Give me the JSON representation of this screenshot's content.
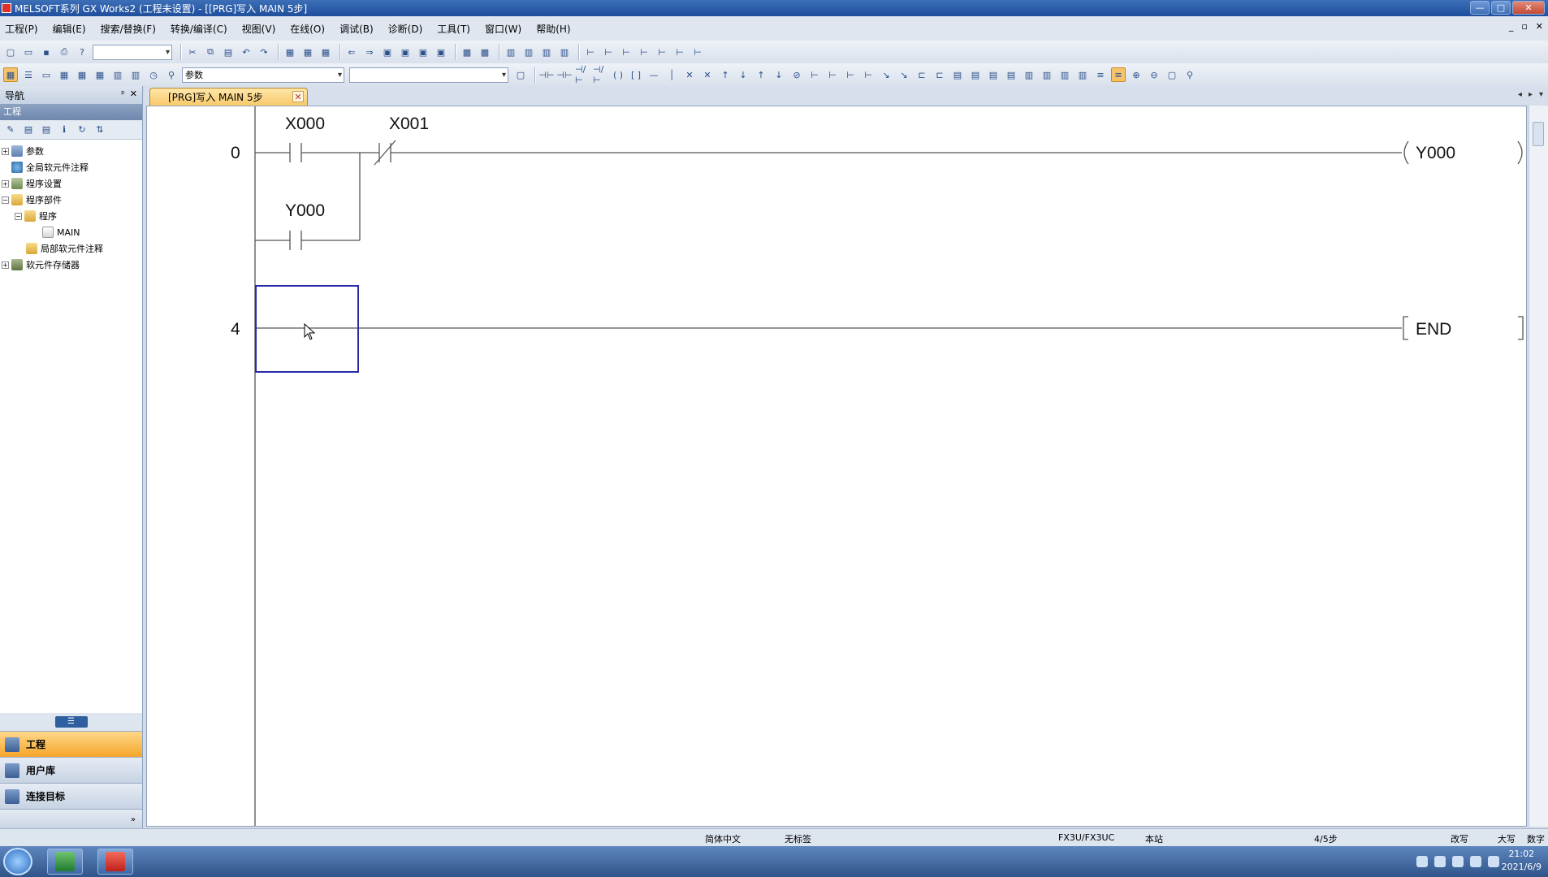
{
  "window": {
    "title": "MELSOFT系列 GX Works2 (工程未设置) - [[PRG]写入 MAIN 5步]",
    "min": "—",
    "max": "□",
    "close": "✕"
  },
  "menu": [
    "工程(P)",
    "编辑(E)",
    "搜索/替换(F)",
    "转换/编译(C)",
    "视图(V)",
    "在线(O)",
    "调试(B)",
    "诊断(D)",
    "工具(T)",
    "窗口(W)",
    "帮助(H)"
  ],
  "toolbar2": {
    "device_combo_value": "参数"
  },
  "nav": {
    "title": "导航",
    "pin": "ᵖ",
    "close": "✕",
    "section": "工程",
    "tree": [
      {
        "label": "参数",
        "level": 0,
        "exp": "+",
        "icon": "param-icon"
      },
      {
        "label": "全局软元件注释",
        "level": 0,
        "exp": "",
        "icon": "globe-icon"
      },
      {
        "label": "程序设置",
        "level": 0,
        "exp": "+",
        "icon": "settings-icon"
      },
      {
        "label": "程序部件",
        "level": 0,
        "exp": "−",
        "icon": "folder-icon"
      },
      {
        "label": "程序",
        "level": 1,
        "exp": "−",
        "icon": "folder-icon"
      },
      {
        "label": "MAIN",
        "level": 2,
        "exp": "",
        "icon": "program-icon"
      },
      {
        "label": "局部软元件注释",
        "level": 1,
        "exp": "",
        "icon": "folder-icon"
      },
      {
        "label": "软元件存储器",
        "level": 0,
        "exp": "+",
        "icon": "memory-icon"
      }
    ],
    "tabs": [
      "工程",
      "用户库",
      "连接目标"
    ],
    "active_tab": "工程"
  },
  "doc_tab": {
    "label": "[PRG]写入 MAIN 5步",
    "close": "✕"
  },
  "ladder": {
    "rungs": [
      {
        "step": "0",
        "contact1": "X000",
        "contact2": "X001",
        "parallel": "Y000",
        "coil": "Y000"
      },
      {
        "step": "4",
        "instruction": "END"
      }
    ],
    "cursor_cell": "rung-4-col-1"
  },
  "status": {
    "language": "简体中文",
    "label": "无标签",
    "plc": "FX3U/FX3UC",
    "station": "本站",
    "steps": "4/5步",
    "mode": "改写",
    "caps": "大写",
    "num": "数字"
  },
  "clock": {
    "time": "21:02",
    "date": "2021/6/9"
  }
}
